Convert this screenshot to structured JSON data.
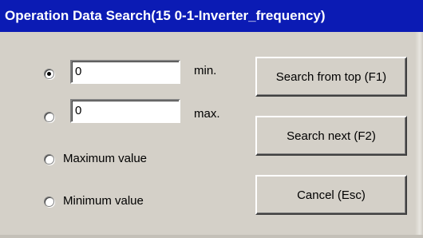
{
  "window": {
    "title": "Operation Data Search(15 0-1-Inverter_frequency)"
  },
  "options": {
    "min_value": "0",
    "min_label": "min.",
    "max_value": "0",
    "max_label": "max.",
    "maximum_label": "Maximum value",
    "minimum_label": "Minimum value",
    "selected": "min"
  },
  "buttons": {
    "search_top": "Search from top (F1)",
    "search_next": "Search next (F2)",
    "cancel": "Cancel (Esc)"
  },
  "colors": {
    "titlebar": "#0b1bb4",
    "face": "#d4d0c8"
  }
}
